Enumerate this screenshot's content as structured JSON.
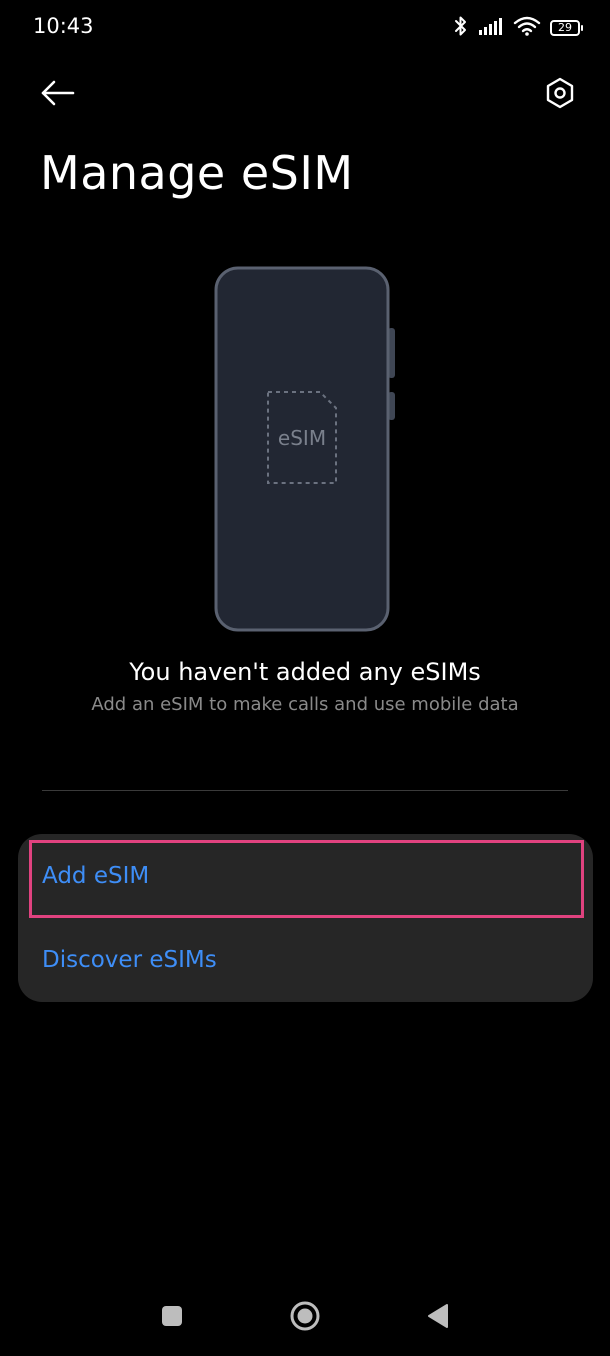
{
  "status_bar": {
    "time": "10:43",
    "battery_level": "29",
    "icons": [
      "bluetooth-icon",
      "signal-icon",
      "wifi-icon",
      "battery-icon"
    ]
  },
  "header": {
    "back_icon": "arrow-left-icon",
    "settings_icon": "hexagon-gear-icon",
    "title": "Manage eSIM"
  },
  "illustration": {
    "sim_label": "eSIM"
  },
  "empty_state": {
    "title": "You haven't added any eSIMs",
    "subtitle": "Add an eSIM to make calls and use mobile data"
  },
  "options": [
    {
      "label": "Add eSIM",
      "highlighted": true
    },
    {
      "label": "Discover eSIMs",
      "highlighted": false
    }
  ],
  "nav_bar": {
    "icons": [
      "square-recents-icon",
      "circle-home-icon",
      "triangle-back-icon"
    ]
  },
  "colors": {
    "background": "#000000",
    "card": "#262626",
    "accent": "#3e8ef7",
    "highlight": "#e0427f",
    "secondary_text": "#8a8a8a"
  }
}
